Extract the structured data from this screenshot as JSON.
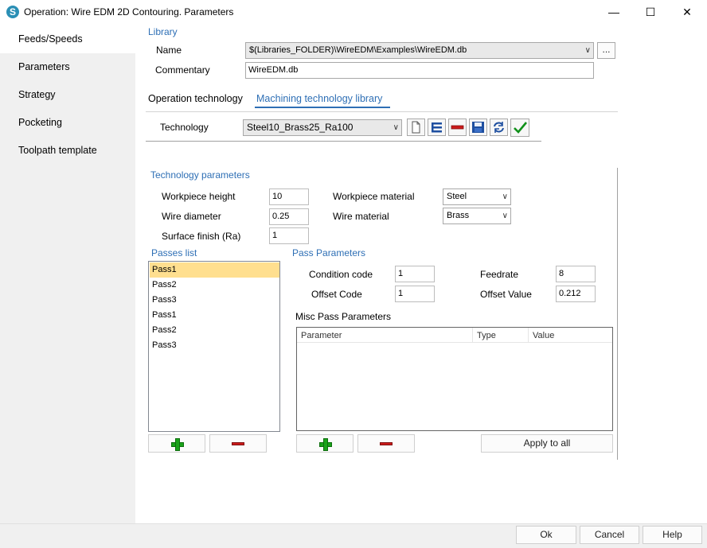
{
  "window": {
    "title": "Operation: Wire EDM 2D Contouring. Parameters",
    "minimize": "—",
    "maximize": "☐",
    "close": "✕"
  },
  "sidebar": {
    "items": [
      {
        "label": "Feeds/Speeds"
      },
      {
        "label": "Parameters"
      },
      {
        "label": "Strategy"
      },
      {
        "label": "Pocketing"
      },
      {
        "label": "Toolpath template"
      }
    ],
    "active_index": 0
  },
  "library": {
    "section_label": "Library",
    "name_label": "Name",
    "name_value": "$(Libraries_FOLDER)\\WireEDM\\Examples\\WireEDM.db",
    "browse_label": "...",
    "commentary_label": "Commentary",
    "commentary_value": "WireEDM.db"
  },
  "tabs": [
    {
      "label": "Operation technology",
      "active": false
    },
    {
      "label": "Machining technology library",
      "active": true
    }
  ],
  "technology": {
    "label": "Technology",
    "value": "Steel10_Brass25_Ra100",
    "toolbar_icons": [
      "new-document-icon",
      "insert-icon",
      "delete-icon",
      "save-icon",
      "refresh-icon",
      "apply-check-icon"
    ]
  },
  "tech_params": {
    "section_label": "Technology parameters",
    "workpiece_height_label": "Workpiece height",
    "workpiece_height_value": "10",
    "wire_diameter_label": "Wire diameter",
    "wire_diameter_value": "0.25",
    "surface_finish_label": "Surface finish (Ra)",
    "surface_finish_value": "1",
    "workpiece_material_label": "Workpiece material",
    "workpiece_material_value": "Steel",
    "wire_material_label": "Wire material",
    "wire_material_value": "Brass"
  },
  "passes": {
    "section_label": "Passes list",
    "items": [
      "Pass1",
      "Pass2",
      "Pass3",
      "Pass1",
      "Pass2",
      "Pass3"
    ],
    "selected_index": 0
  },
  "pass_params": {
    "section_label": "Pass Parameters",
    "condition_code_label": "Condition code",
    "condition_code_value": "1",
    "offset_code_label": "Offset Code",
    "offset_code_value": "1",
    "feedrate_label": "Feedrate",
    "feedrate_value": "8",
    "offset_value_label": "Offset Value",
    "offset_value_value": "0.212"
  },
  "misc": {
    "section_label": "Misc Pass Parameters",
    "columns": [
      "Parameter",
      "Type",
      "Value"
    ],
    "apply_all_label": "Apply to all"
  },
  "footer": {
    "ok": "Ok",
    "cancel": "Cancel",
    "help": "Help"
  },
  "colors": {
    "accent_blue": "#2e6fb5",
    "selected_row": "#ffdf8f",
    "sidebar_bg": "#f0f0f0"
  }
}
